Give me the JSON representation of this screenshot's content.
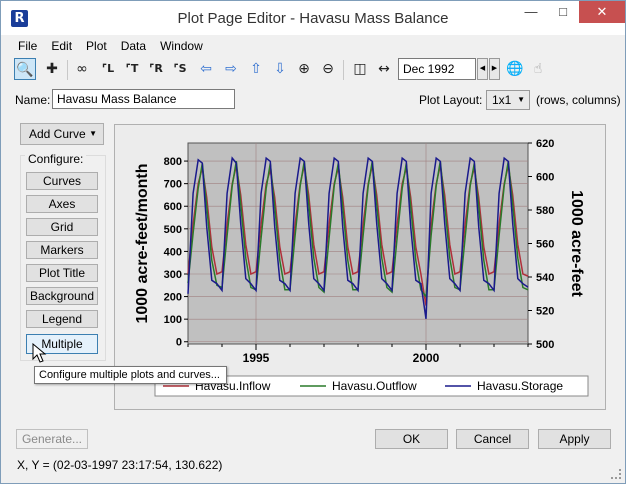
{
  "window": {
    "title": "Plot Page Editor - Havasu Mass Balance",
    "app_icon": "R"
  },
  "menu": [
    "File",
    "Edit",
    "Plot",
    "Data",
    "Window"
  ],
  "toolbar": {
    "date_value": "Dec 1992",
    "icons": [
      "zoom-icon",
      "crosshair-icon",
      "link-icon",
      "axis-scale-l-icon",
      "axis-scale-t-icon",
      "axis-scale-r-icon",
      "axis-scale-s-icon",
      "arrow-left-icon",
      "arrow-right-icon",
      "arrow-up-icon",
      "arrow-down-icon",
      "zoom-in-icon",
      "zoom-out-icon",
      "split-icon",
      "collapse-icon",
      "globe-icon",
      "cursor-pin-icon"
    ]
  },
  "name_label": "Name:",
  "name_value": "Havasu Mass Balance",
  "plot_layout": {
    "label": "Plot Layout:",
    "value": "1x1",
    "hint": "(rows, columns)"
  },
  "add_curve_label": "Add Curve",
  "configure": {
    "title": "Configure:",
    "buttons": [
      "Curves",
      "Axes",
      "Grid",
      "Markers",
      "Plot Title",
      "Background",
      "Legend",
      "Multiple"
    ]
  },
  "tooltip": "Configure multiple plots and curves...",
  "buttons": {
    "generate": "Generate...",
    "ok": "OK",
    "cancel": "Cancel",
    "apply": "Apply"
  },
  "status_text": "X, Y = (02-03-1997 23:17:54, 130.622)",
  "colors": {
    "inflow": "#b0303a",
    "outflow": "#2a7a2a",
    "storage": "#1a1a8c",
    "plot_bg": "#c0c0c0",
    "accent": "#3c7fb1"
  },
  "chart_data": {
    "type": "line",
    "ylabel_left": "1000 acre-feet/month",
    "ylabel_right": "1000 acre-feet",
    "x_ticks": [
      "1995",
      "2000"
    ],
    "x_range": [
      1993.0,
      2003.0
    ],
    "y_left_ticks": [
      0,
      100,
      200,
      300,
      400,
      500,
      600,
      700,
      800
    ],
    "y_left_range": [
      -10,
      880
    ],
    "y_right_ticks": [
      500,
      520,
      540,
      560,
      580,
      600,
      620
    ],
    "y_right_range": [
      500,
      620
    ],
    "grid": true,
    "legend_position": "bottom",
    "series": [
      {
        "name": "Havasu.Inflow",
        "axis": "left",
        "color": "#b0303a",
        "x": [
          1993.0,
          1993.15,
          1993.3,
          1993.42,
          1993.55,
          1993.7,
          1993.85,
          1994.0,
          1994.15,
          1994.3,
          1994.42,
          1994.55,
          1994.7,
          1994.85,
          1995.0,
          1995.15,
          1995.3,
          1995.42,
          1995.55,
          1995.7,
          1995.85,
          1996.0,
          1996.15,
          1996.3,
          1996.42,
          1996.55,
          1996.7,
          1996.85,
          1997.0,
          1997.15,
          1997.3,
          1997.42,
          1997.55,
          1997.7,
          1997.85,
          1998.0,
          1998.15,
          1998.3,
          1998.42,
          1998.55,
          1998.7,
          1998.85,
          1999.0,
          1999.15,
          1999.3,
          1999.42,
          1999.55,
          1999.7,
          1999.85,
          2000.0,
          2000.15,
          2000.3,
          2000.42,
          2000.55,
          2000.7,
          2000.85,
          2001.0,
          2001.15,
          2001.3,
          2001.42,
          2001.55,
          2001.7,
          2001.85,
          2002.0,
          2002.15,
          2002.3,
          2002.42,
          2002.55,
          2002.7,
          2002.85,
          2003.0
        ],
        "y": [
          300,
          520,
          700,
          770,
          640,
          420,
          300,
          310,
          520,
          700,
          780,
          650,
          430,
          300,
          310,
          520,
          700,
          760,
          640,
          420,
          300,
          310,
          520,
          700,
          780,
          650,
          430,
          300,
          310,
          520,
          700,
          770,
          640,
          420,
          300,
          310,
          520,
          700,
          780,
          650,
          430,
          300,
          310,
          520,
          700,
          770,
          640,
          420,
          300,
          160,
          520,
          700,
          780,
          650,
          430,
          300,
          310,
          520,
          700,
          770,
          640,
          420,
          300,
          310,
          520,
          700,
          780,
          650,
          430,
          300,
          290
        ]
      },
      {
        "name": "Havasu.Outflow",
        "axis": "left",
        "color": "#2a7a2a",
        "x": [
          1993.0,
          1993.15,
          1993.3,
          1993.42,
          1993.55,
          1993.7,
          1993.85,
          1994.0,
          1994.15,
          1994.3,
          1994.42,
          1994.55,
          1994.7,
          1994.85,
          1995.0,
          1995.15,
          1995.3,
          1995.42,
          1995.55,
          1995.7,
          1995.85,
          1996.0,
          1996.15,
          1996.3,
          1996.42,
          1996.55,
          1996.7,
          1996.85,
          1997.0,
          1997.15,
          1997.3,
          1997.42,
          1997.55,
          1997.7,
          1997.85,
          1998.0,
          1998.15,
          1998.3,
          1998.42,
          1998.55,
          1998.7,
          1998.85,
          1999.0,
          1999.15,
          1999.3,
          1999.42,
          1999.55,
          1999.7,
          1999.85,
          2000.0,
          2000.15,
          2000.3,
          2000.42,
          2000.55,
          2000.7,
          2000.85,
          2001.0,
          2001.15,
          2001.3,
          2001.42,
          2001.55,
          2001.7,
          2001.85,
          2002.0,
          2002.15,
          2002.3,
          2002.42,
          2002.55,
          2002.7,
          2002.85,
          2003.0
        ],
        "y": [
          260,
          480,
          680,
          790,
          600,
          360,
          250,
          240,
          470,
          690,
          800,
          610,
          370,
          240,
          230,
          460,
          680,
          790,
          600,
          360,
          230,
          230,
          470,
          690,
          800,
          610,
          370,
          240,
          220,
          460,
          690,
          790,
          600,
          360,
          230,
          230,
          470,
          690,
          800,
          610,
          370,
          240,
          220,
          460,
          680,
          790,
          600,
          360,
          230,
          200,
          470,
          690,
          800,
          610,
          370,
          240,
          230,
          460,
          690,
          790,
          600,
          360,
          230,
          230,
          470,
          690,
          800,
          610,
          370,
          240,
          230
        ]
      },
      {
        "name": "Havasu.Storage",
        "axis": "right",
        "color": "#1a1a8c",
        "x": [
          1993.0,
          1993.15,
          1993.3,
          1993.42,
          1993.55,
          1993.7,
          1993.85,
          1994.0,
          1994.15,
          1994.3,
          1994.42,
          1994.55,
          1994.7,
          1994.85,
          1995.0,
          1995.15,
          1995.3,
          1995.42,
          1995.55,
          1995.7,
          1995.85,
          1996.0,
          1996.15,
          1996.3,
          1996.42,
          1996.55,
          1996.7,
          1996.85,
          1997.0,
          1997.15,
          1997.3,
          1997.42,
          1997.55,
          1997.7,
          1997.85,
          1998.0,
          1998.15,
          1998.3,
          1998.42,
          1998.55,
          1998.7,
          1998.85,
          1999.0,
          1999.15,
          1999.3,
          1999.42,
          1999.55,
          1999.7,
          1999.85,
          2000.0,
          2000.15,
          2000.3,
          2000.42,
          2000.55,
          2000.7,
          2000.85,
          2001.0,
          2001.15,
          2001.3,
          2001.42,
          2001.55,
          2001.7,
          2001.85,
          2002.0,
          2002.15,
          2002.3,
          2002.42,
          2002.55,
          2002.7,
          2002.85,
          2003.0
        ],
        "y": [
          530,
          590,
          610,
          608,
          570,
          538,
          536,
          532,
          590,
          611,
          608,
          572,
          539,
          536,
          532,
          590,
          611,
          609,
          570,
          538,
          536,
          532,
          590,
          611,
          609,
          572,
          539,
          536,
          532,
          590,
          611,
          609,
          570,
          538,
          536,
          532,
          590,
          611,
          609,
          572,
          539,
          536,
          532,
          590,
          611,
          609,
          570,
          538,
          536,
          515,
          590,
          611,
          609,
          572,
          539,
          536,
          532,
          590,
          611,
          609,
          570,
          538,
          536,
          532,
          590,
          611,
          609,
          572,
          539,
          536,
          534
        ]
      }
    ]
  }
}
